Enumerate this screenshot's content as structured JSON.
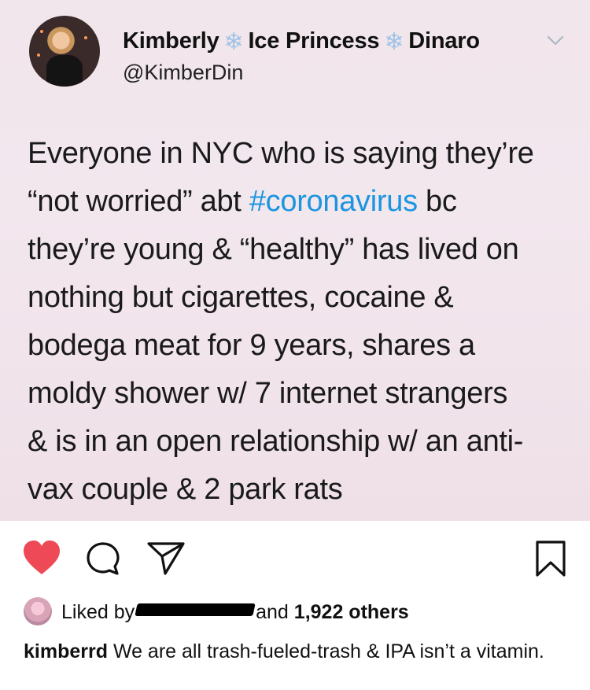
{
  "tweet": {
    "display_name": {
      "part1": "Kimberly",
      "part2": "Ice Princess",
      "part3": "Dinaro",
      "separator_icon": "snowflake-icon"
    },
    "handle": "@KimberDin",
    "text_lines": [
      "Everyone in NYC who is saying they’re",
      "“not worried” abt ",
      "they’re young & “healthy” has lived on",
      "nothing but cigarettes, cocaine &",
      "bodega meat for 9 years, shares a",
      "moldy shower w/ 7 internet strangers",
      "& is in an open relationship w/ an anti-",
      "vax couple & 2 park rats"
    ],
    "hashtag": "#coronavirus",
    "line2_after": " bc"
  },
  "actions": {
    "like_icon": "heart-icon",
    "comment_icon": "comment-icon",
    "share_icon": "share-icon",
    "save_icon": "bookmark-icon",
    "liked": true,
    "colors": {
      "like": "#ed4956",
      "hashtag": "#1b95e0"
    }
  },
  "likes": {
    "prefix": "Liked by",
    "suffix_and": "and",
    "others": "1,922 others"
  },
  "caption": {
    "username": "kimberrd",
    "text": "We are all trash-fueled-trash & IPA isn’t a vitamin."
  }
}
